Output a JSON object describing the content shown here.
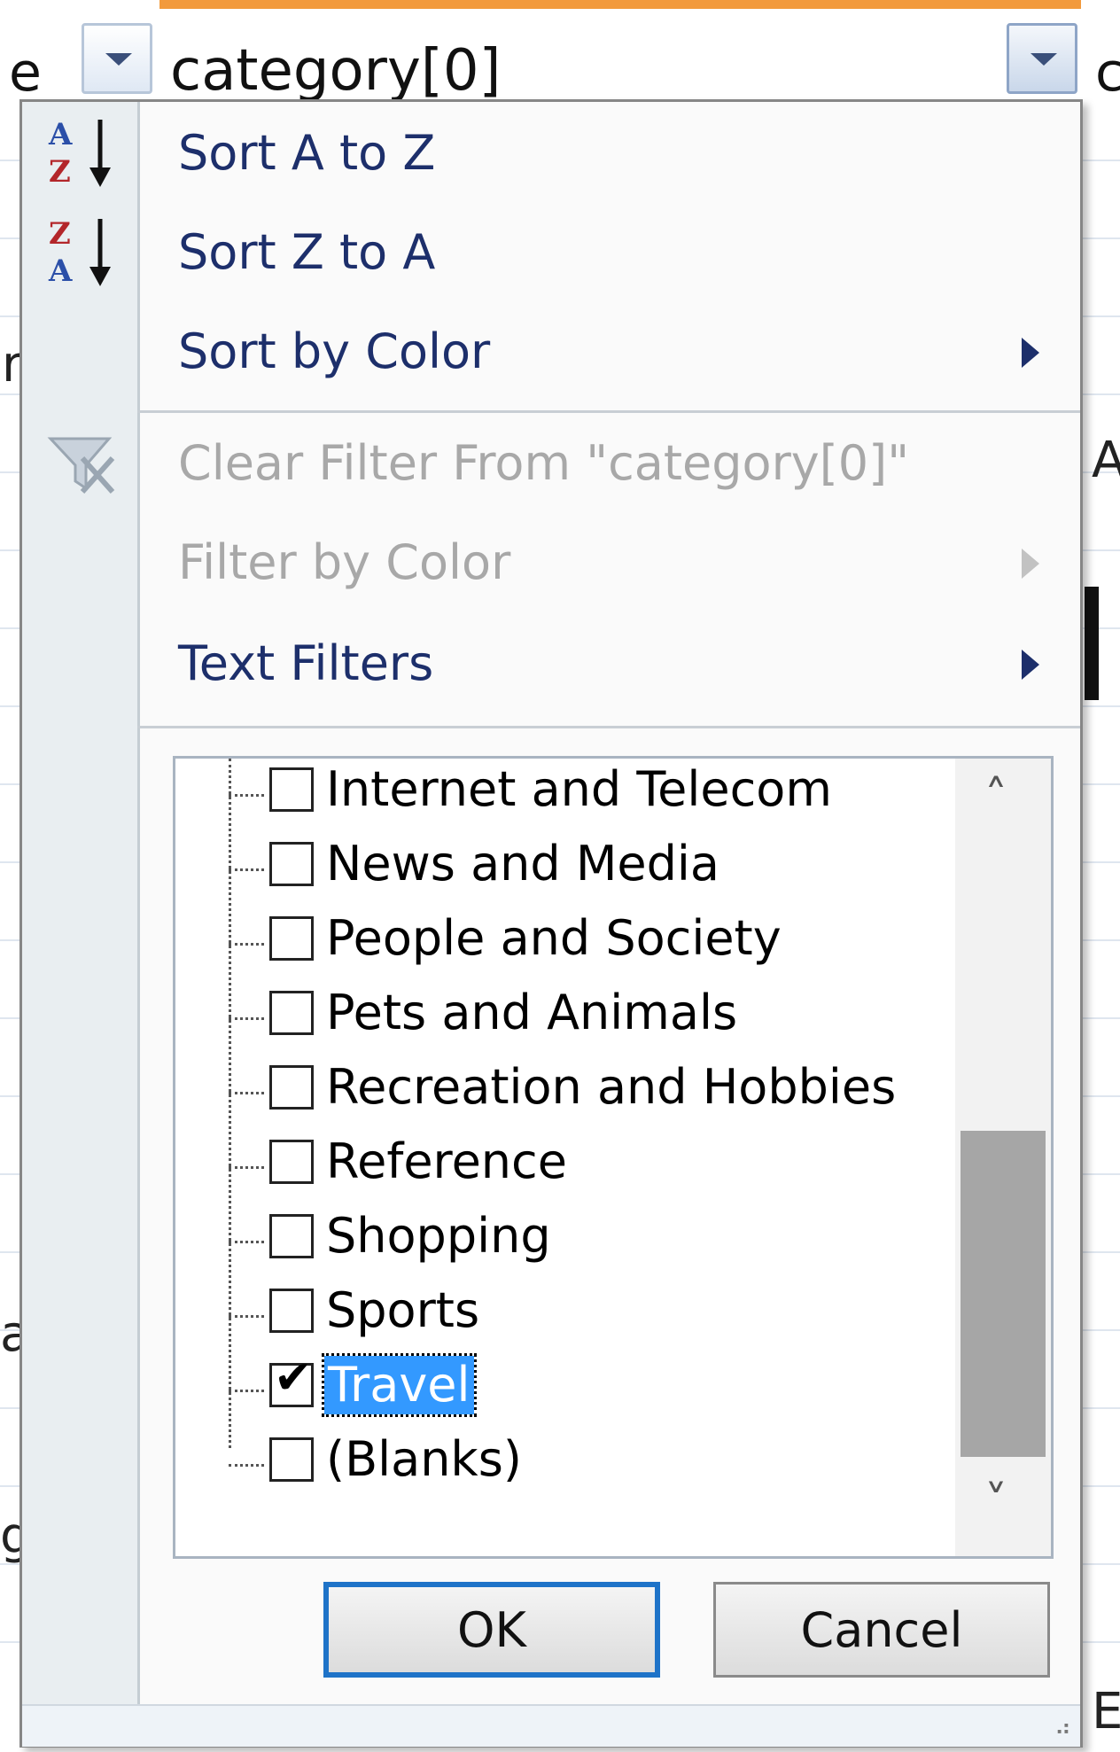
{
  "sheet": {
    "left_header_fragment": "e",
    "column_header": "category[0]",
    "right_header_fragment": "c",
    "side_fragments": [
      "r",
      "A",
      "a",
      "g",
      "E"
    ]
  },
  "menu": {
    "items": [
      {
        "label": "Sort A to Z",
        "icon": "sort-a-to-z-icon"
      },
      {
        "label": "Sort Z to A",
        "icon": "sort-z-to-a-icon"
      },
      {
        "label": "Sort by Color",
        "submenu": true
      },
      {
        "label": "Clear Filter From \"category[0]\"",
        "icon": "clear-filter-icon",
        "disabled": true
      },
      {
        "label": "Filter by Color",
        "submenu": true,
        "disabled": true
      },
      {
        "label": "Text Filters",
        "submenu": true
      }
    ]
  },
  "filter_list": {
    "items": [
      {
        "label": "Internet and Telecom",
        "checked": false
      },
      {
        "label": "News and Media",
        "checked": false
      },
      {
        "label": "People and Society",
        "checked": false
      },
      {
        "label": "Pets and Animals",
        "checked": false
      },
      {
        "label": "Recreation and Hobbies",
        "checked": false
      },
      {
        "label": "Reference",
        "checked": false
      },
      {
        "label": "Shopping",
        "checked": false
      },
      {
        "label": "Sports",
        "checked": false
      },
      {
        "label": "Travel",
        "checked": true,
        "selected": true
      },
      {
        "label": "(Blanks)",
        "checked": false
      }
    ],
    "scroll_position": 0.85
  },
  "buttons": {
    "ok": "OK",
    "cancel": "Cancel"
  },
  "colors": {
    "menu_text": "#1d2f6b",
    "selection": "#3399ff",
    "default_button_border": "#1e73c8",
    "column_accent": "#f29a3c"
  }
}
